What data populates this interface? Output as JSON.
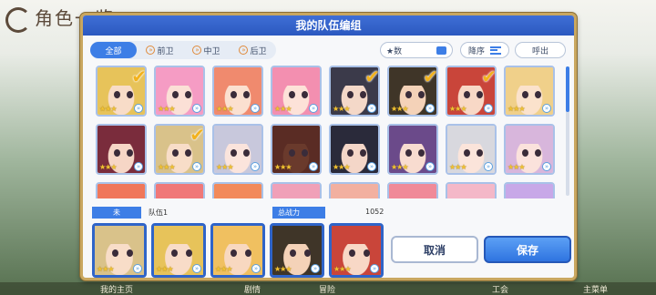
{
  "background": {
    "title": "角色一览",
    "bottom_labels": [
      "我的主页",
      "剧情",
      "冒险",
      "工会",
      "主菜单"
    ]
  },
  "dialog": {
    "title": "我的队伍编组",
    "filter_tabs": [
      {
        "label": "全部",
        "active": true
      },
      {
        "label": "前卫",
        "active": false
      },
      {
        "label": "中卫",
        "active": false
      },
      {
        "label": "后卫",
        "active": false
      }
    ],
    "sort_key": "★数",
    "sort_order": "降序",
    "call_button": "呼出",
    "team_slot_label": "未",
    "team_name": "队伍1",
    "power_label": "总战力",
    "power_value": "1052",
    "cancel_button": "取消",
    "save_button": "保存"
  },
  "roster": [
    {
      "hair": "#e7c35a",
      "skin": "#f8dcc8",
      "stars": 3,
      "selected": true
    },
    {
      "hair": "#f59cc4",
      "skin": "#fbe0d6",
      "stars": 3,
      "selected": false
    },
    {
      "hair": "#f08a6e",
      "skin": "#fbe0d0",
      "stars": 3,
      "selected": false
    },
    {
      "hair": "#f38fb0",
      "skin": "#fde2d8",
      "stars": 3,
      "selected": false
    },
    {
      "hair": "#3b3a4a",
      "skin": "#f4d8c8",
      "stars": 3,
      "selected": true
    },
    {
      "hair": "#3f3528",
      "skin": "#f4d2b8",
      "stars": 3,
      "selected": true
    },
    {
      "hair": "#c9453a",
      "skin": "#f8d8c6",
      "stars": 3,
      "selected": true
    },
    {
      "hair": "#f0d08a",
      "skin": "#fbe2cc",
      "stars": 3,
      "selected": false
    },
    {
      "hair": "#7a2c3c",
      "skin": "#f6d6c6",
      "stars": 3,
      "selected": false
    },
    {
      "hair": "#d9c28a",
      "skin": "#f8ddc8",
      "stars": 3,
      "selected": true
    },
    {
      "hair": "#c8c8dc",
      "skin": "#fbe4dc",
      "stars": 3,
      "selected": false
    },
    {
      "hair": "#5a2c24",
      "skin": "#6a3a2c",
      "stars": 3,
      "selected": false
    },
    {
      "hair": "#2a2a3a",
      "skin": "#f4d6c8",
      "stars": 3,
      "selected": false
    },
    {
      "hair": "#6b4a8a",
      "skin": "#f8dcd0",
      "stars": 3,
      "selected": false
    },
    {
      "hair": "#d8d8de",
      "skin": "#fbe4da",
      "stars": 3,
      "selected": false
    },
    {
      "hair": "#d8b6dc",
      "skin": "#fbe2dc",
      "stars": 3,
      "selected": false
    },
    {
      "hair": "#f0775a",
      "skin": "#fbd8c8",
      "stars": 3,
      "selected": false
    },
    {
      "hair": "#f07878",
      "skin": "#fbd8c8",
      "stars": 3,
      "selected": false
    },
    {
      "hair": "#f28a5a",
      "skin": "#fbdcc8",
      "stars": 3,
      "selected": false
    },
    {
      "hair": "#f0a0b8",
      "skin": "#fde0d8",
      "stars": 3,
      "selected": false
    },
    {
      "hair": "#f2b0a0",
      "skin": "#fde0d0",
      "stars": 3,
      "selected": false
    },
    {
      "hair": "#f08a98",
      "skin": "#fbdcd4",
      "stars": 3,
      "selected": false
    },
    {
      "hair": "#f4b8c8",
      "skin": "#fde2dc",
      "stars": 3,
      "selected": false
    },
    {
      "hair": "#c8a8e8",
      "skin": "#fbe0dc",
      "stars": 3,
      "selected": false
    }
  ],
  "team": [
    {
      "hair": "#d9c28a",
      "skin": "#f8ddc8",
      "stars": 3
    },
    {
      "hair": "#e7c35a",
      "skin": "#f8dcc8",
      "stars": 3
    },
    {
      "hair": "#f0c060",
      "skin": "#f8d8c0",
      "stars": 3
    },
    {
      "hair": "#3f3528",
      "skin": "#f4d2b8",
      "stars": 3
    },
    {
      "hair": "#c9453a",
      "skin": "#f8d8c6",
      "stars": 3
    }
  ]
}
